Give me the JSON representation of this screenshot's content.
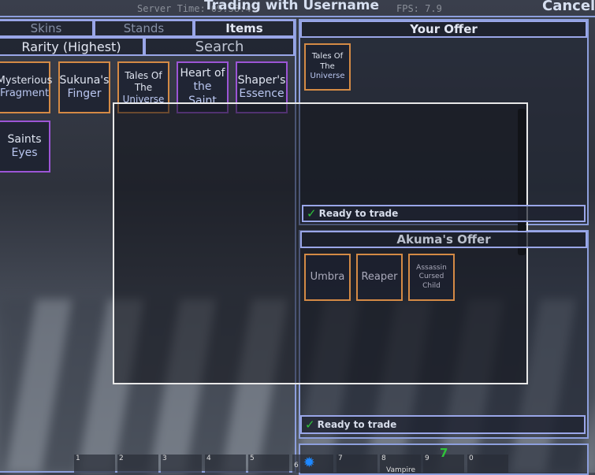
{
  "header": {
    "server_time": "Server Time: 09:58:4",
    "title": "Trading with Username",
    "fps": "FPS: 7.9",
    "cancel": "Cancel"
  },
  "tabs": [
    {
      "label": "Skins"
    },
    {
      "label": "Stands"
    },
    {
      "label": "Items"
    }
  ],
  "sort_label": "Rarity (Highest)",
  "search_placeholder": "Search",
  "inventory": [
    {
      "l1": "Mysterious",
      "l2": "Fragment",
      "rarity": "orange"
    },
    {
      "l1": "Sukuna's",
      "l2": "Finger",
      "rarity": "orange"
    },
    {
      "l1": "Tales Of The",
      "l2": "Universe",
      "rarity": "orange"
    },
    {
      "l1": "Heart of",
      "l2": "the Saint",
      "rarity": "purple"
    },
    {
      "l1": "Shaper's",
      "l2": "Essence",
      "rarity": "purple"
    },
    {
      "l1": "Saints",
      "l2": "Eyes",
      "rarity": "purple"
    }
  ],
  "your_offer": {
    "title": "Your Offer",
    "items": [
      {
        "l1": "Tales Of The",
        "l2": "Universe"
      }
    ],
    "ready": "Ready to trade"
  },
  "their_offer": {
    "title": "Akuma's Offer",
    "items": [
      {
        "l1": "Umbra",
        "l2": ""
      },
      {
        "l1": "Reaper",
        "l2": ""
      },
      {
        "l1": "Assassin",
        "l2": "Cursed Child"
      }
    ],
    "ready": "Ready to trade"
  },
  "hotbar": {
    "slots": [
      "1",
      "2",
      "3",
      "4",
      "5",
      "6",
      "7",
      "8",
      "9",
      "0"
    ],
    "slot8_label": "Vampire",
    "badge": "7"
  },
  "colors": {
    "accent": "#8d9fdd",
    "orange": "#d48a45",
    "purple": "#9c55d6",
    "check": "#2fc33a"
  }
}
